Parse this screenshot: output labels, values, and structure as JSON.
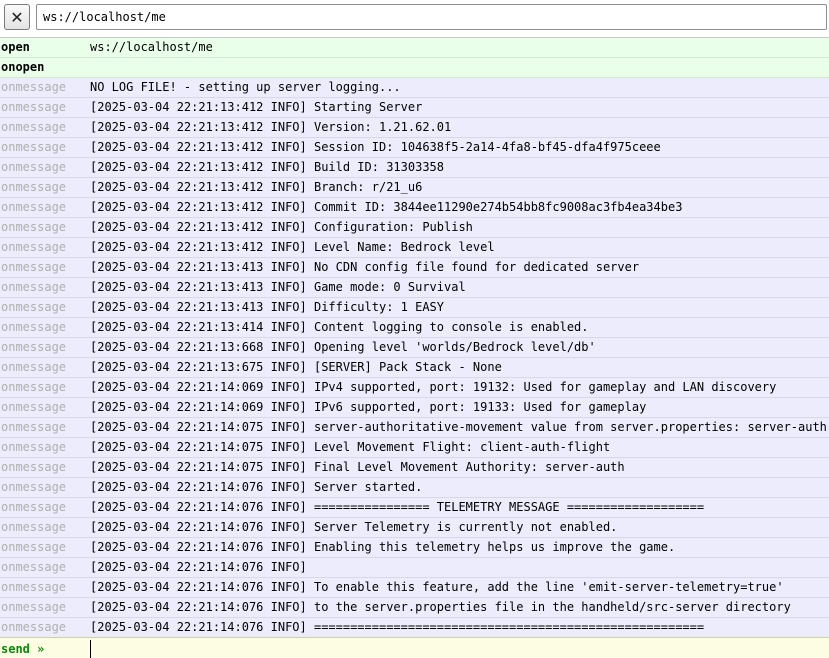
{
  "toolbar": {
    "close_glyph": "✕",
    "url_value": "ws://localhost/me"
  },
  "log": {
    "rows": [
      {
        "kind": "open",
        "text": "ws://localhost/me",
        "type": "open"
      },
      {
        "kind": "onopen",
        "text": "",
        "type": "open"
      },
      {
        "kind": "onmessage",
        "text": "NO LOG FILE! - setting up server logging...",
        "type": "msg"
      },
      {
        "kind": "onmessage",
        "text": "[2025-03-04 22:21:13:412 INFO] Starting Server",
        "type": "msg"
      },
      {
        "kind": "onmessage",
        "text": "[2025-03-04 22:21:13:412 INFO] Version: 1.21.62.01",
        "type": "msg"
      },
      {
        "kind": "onmessage",
        "text": "[2025-03-04 22:21:13:412 INFO] Session ID: 104638f5-2a14-4fa8-bf45-dfa4f975ceee",
        "type": "msg"
      },
      {
        "kind": "onmessage",
        "text": "[2025-03-04 22:21:13:412 INFO] Build ID: 31303358",
        "type": "msg"
      },
      {
        "kind": "onmessage",
        "text": "[2025-03-04 22:21:13:412 INFO] Branch: r/21_u6",
        "type": "msg"
      },
      {
        "kind": "onmessage",
        "text": "[2025-03-04 22:21:13:412 INFO] Commit ID: 3844ee11290e274b54bb8fc9008ac3fb4ea34be3",
        "type": "msg"
      },
      {
        "kind": "onmessage",
        "text": "[2025-03-04 22:21:13:412 INFO] Configuration: Publish",
        "type": "msg"
      },
      {
        "kind": "onmessage",
        "text": "[2025-03-04 22:21:13:412 INFO] Level Name: Bedrock level",
        "type": "msg"
      },
      {
        "kind": "onmessage",
        "text": "[2025-03-04 22:21:13:413 INFO] No CDN config file found for dedicated server",
        "type": "msg"
      },
      {
        "kind": "onmessage",
        "text": "[2025-03-04 22:21:13:413 INFO] Game mode: 0 Survival",
        "type": "msg"
      },
      {
        "kind": "onmessage",
        "text": "[2025-03-04 22:21:13:413 INFO] Difficulty: 1 EASY",
        "type": "msg"
      },
      {
        "kind": "onmessage",
        "text": "[2025-03-04 22:21:13:414 INFO] Content logging to console is enabled.",
        "type": "msg"
      },
      {
        "kind": "onmessage",
        "text": "[2025-03-04 22:21:13:668 INFO] Opening level 'worlds/Bedrock level/db'",
        "type": "msg"
      },
      {
        "kind": "onmessage",
        "text": "[2025-03-04 22:21:13:675 INFO] [SERVER] Pack Stack - None",
        "type": "msg"
      },
      {
        "kind": "onmessage",
        "text": "[2025-03-04 22:21:14:069 INFO] IPv4 supported, port: 19132: Used for gameplay and LAN discovery",
        "type": "msg"
      },
      {
        "kind": "onmessage",
        "text": "[2025-03-04 22:21:14:069 INFO] IPv6 supported, port: 19133: Used for gameplay",
        "type": "msg"
      },
      {
        "kind": "onmessage",
        "text": "[2025-03-04 22:21:14:075 INFO] server-authoritative-movement value from server.properties: server-auth",
        "type": "msg"
      },
      {
        "kind": "onmessage",
        "text": "[2025-03-04 22:21:14:075 INFO] Level Movement Flight: client-auth-flight",
        "type": "msg"
      },
      {
        "kind": "onmessage",
        "text": "[2025-03-04 22:21:14:075 INFO] Final Level Movement Authority: server-auth",
        "type": "msg"
      },
      {
        "kind": "onmessage",
        "text": "[2025-03-04 22:21:14:076 INFO] Server started.",
        "type": "msg"
      },
      {
        "kind": "onmessage",
        "text": "[2025-03-04 22:21:14:076 INFO] ================ TELEMETRY MESSAGE ===================",
        "type": "msg"
      },
      {
        "kind": "onmessage",
        "text": "[2025-03-04 22:21:14:076 INFO] Server Telemetry is currently not enabled.",
        "type": "msg"
      },
      {
        "kind": "onmessage",
        "text": "[2025-03-04 22:21:14:076 INFO] Enabling this telemetry helps us improve the game.",
        "type": "msg"
      },
      {
        "kind": "onmessage",
        "text": "[2025-03-04 22:21:14:076 INFO]",
        "type": "msg"
      },
      {
        "kind": "onmessage",
        "text": "[2025-03-04 22:21:14:076 INFO] To enable this feature, add the line 'emit-server-telemetry=true'",
        "type": "msg"
      },
      {
        "kind": "onmessage",
        "text": "[2025-03-04 22:21:14:076 INFO] to the server.properties file in the handheld/src-server directory",
        "type": "msg"
      },
      {
        "kind": "onmessage",
        "text": "[2025-03-04 22:21:14:076 INFO] ======================================================",
        "type": "msg"
      }
    ]
  },
  "sendbar": {
    "label": "send »",
    "value": ""
  },
  "colors": {
    "open_row_bg": "#eaffea",
    "message_row_bg": "#ececfc",
    "send_bar_bg": "#fdfde4",
    "send_label": "#0a8a0a"
  }
}
